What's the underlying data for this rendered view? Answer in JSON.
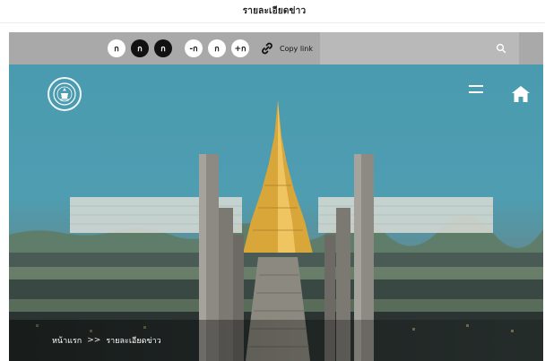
{
  "page_title": "รายละเอียดข่าว",
  "toolbar": {
    "contrast_options": [
      {
        "glyph": "ก",
        "style": "white"
      },
      {
        "glyph": "ก",
        "style": "black"
      },
      {
        "glyph": "ก",
        "style": "yellow"
      }
    ],
    "font_size_options": [
      {
        "glyph": "-ก"
      },
      {
        "glyph": "ก"
      },
      {
        "glyph": "+ก"
      }
    ],
    "copy_link_label": "Copy link",
    "copy_link_icon": "link-icon",
    "search_placeholder": "",
    "search_icon": "search-icon"
  },
  "hero": {
    "logo_icon": "emblem-logo",
    "menu_icon": "hamburger-menu-icon",
    "home_icon": "home-icon"
  },
  "breadcrumb": {
    "home_label": "หน้าแรก",
    "separator": ">>",
    "current_label": "รายละเอียดข่าว"
  },
  "colors": {
    "toolbar_bg": "#a9a9a9",
    "search_bg": "#b9b9b9",
    "sky": "#4a9bb0",
    "gold": "#d9a63a"
  }
}
